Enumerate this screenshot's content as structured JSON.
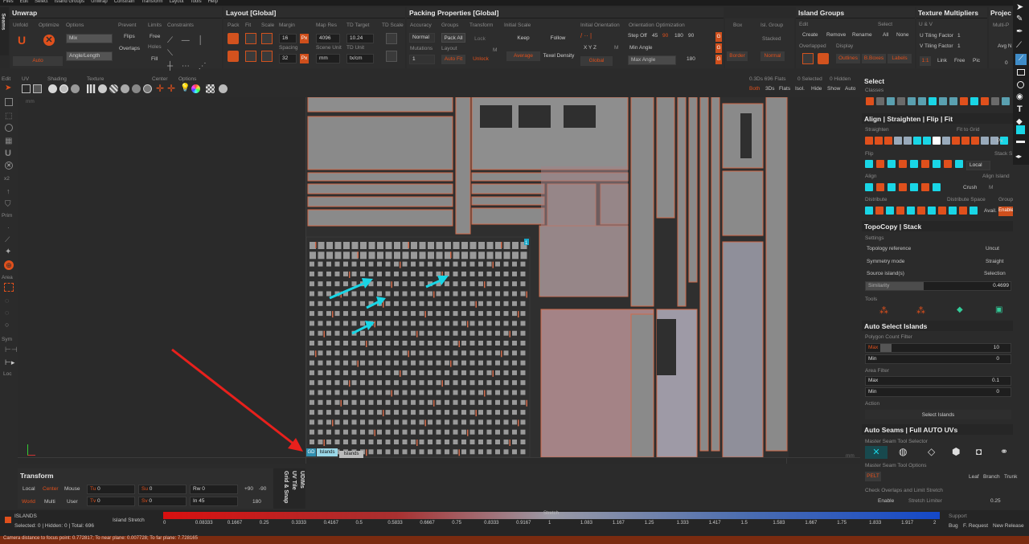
{
  "menu": {
    "items": [
      "Files",
      "Edit",
      "Select",
      "Island Groups",
      "Unwrap",
      "Constrain",
      "Transform",
      "Layout",
      "Tools",
      "Help"
    ]
  },
  "seams_tab": "Seams",
  "unwrap": {
    "title": "Unwrap",
    "sub": [
      "Unfold",
      "Optimize",
      "Options"
    ],
    "mode": "Mix",
    "angle": "Angle/Length",
    "auto": "Auto",
    "prevent": "Prevent",
    "flips": "Flips",
    "overlaps": "Overlaps",
    "limits": "Limits",
    "free": "Free",
    "holes": "Holes",
    "fill": "Fill",
    "constraints": "Constraints"
  },
  "layout": {
    "title": "Layout [Global]",
    "sub": [
      "Pack",
      "Fit",
      "Scale",
      "Margin",
      "Map Res",
      "TD Target",
      "TD Scale"
    ],
    "margin": "16",
    "px": "Px",
    "map_res": "4096",
    "td_target": "10.24",
    "spacing_lbl": "Spacing",
    "spacing": "32",
    "scene_unit_lbl": "Scene Unit",
    "scene_unit": "mm",
    "td_unit_lbl": "TD Unit",
    "td_unit": "tx/cm"
  },
  "packing": {
    "title": "Packing Properties [Global]",
    "sub": [
      "Accuracy",
      "Groups",
      "Transform",
      "Initial Scale",
      "Initial Orientation",
      "Orientation Optimization"
    ],
    "accuracy": "Normal",
    "pack_all": "Pack All",
    "lock": "Lock",
    "mutations_lbl": "Mutations",
    "mutations": "1",
    "layout_lbl": "Layout",
    "auto_fit": "Auto Fit",
    "unlock": "Unlock",
    "m": "M",
    "keep": "Keep",
    "follow": "Follow",
    "average": "Average",
    "texel_density": "Texel Density",
    "xyz": "X  Y  Z",
    "global": "Global",
    "step_off": "Step Off",
    "steps": [
      "45",
      "90",
      "180",
      "90"
    ],
    "min_angle": "Min Angle",
    "max_angle": "Max Angle",
    "max_angle_val": "180",
    "g": "G"
  },
  "box_group": {
    "box": "Box",
    "border": "Border",
    "isl_group": "Isl. Group",
    "stacked": "Stacked",
    "normal": "Normal"
  },
  "island_groups": {
    "title": "Island Groups",
    "edit": "Edit",
    "select": "Select",
    "create": "Create",
    "remove": "Remove",
    "rename": "Rename",
    "all": "All",
    "none": "None",
    "overlapped": "Overlapped",
    "display": "Display",
    "outlines": "Outlines",
    "bboxes": "B.Boxes",
    "labels": "Labels"
  },
  "tex_mult": {
    "title": "Texture Multipliers",
    "uv": "U & V",
    "u_tiling": "U Tiling Factor",
    "u_val": "1",
    "v_tiling": "V Tiling Factor",
    "v_val": "1",
    "ratio": "1:1",
    "link": "Link",
    "free": "Free",
    "pic": "Pic"
  },
  "project": {
    "title": "Projec",
    "multi": "Multi-P",
    "avg": "Avg N",
    "zero": "0"
  },
  "left_tools": {
    "edit": "Edit",
    "prim": "Prim",
    "area": "Area",
    "sym": "Sym",
    "loc": "Loc",
    "x2": "x2"
  },
  "viewport_bar": {
    "uv": "UV",
    "shading": "Shading",
    "texture": "Texture",
    "center": "Center",
    "options": "Options",
    "stats": "0.3Ds 696 Flats",
    "selected": "0 Selected",
    "hidden": "0 Hidden",
    "modes": [
      "Both",
      "3Ds",
      "Flats",
      "Isol.",
      "Hide",
      "Show",
      "Auto"
    ],
    "unit": "mm"
  },
  "viewport": {
    "islands_tag": "GD",
    "islands_label": "Islands",
    "islands2": "Islands",
    "tile_index": "1",
    "unit_right": "mm"
  },
  "select_panel": {
    "title": "Select",
    "classes": "Classes"
  },
  "align_panel": {
    "title": "Align | Straighten | Flip | Fit",
    "straighten": "Straighten",
    "fit_to_grid": "Fit to Grid",
    "px": "Px",
    "flip": "Flip",
    "stack": "Stack S",
    "local": "Local",
    "align": "Align",
    "align_island": "Align Island",
    "crush": "Crush",
    "m": "M",
    "distribute": "Distribute",
    "distribute_space": "Distribute Space",
    "group": "Group",
    "avail": "Avail.",
    "enable": "Enable"
  },
  "topocopy": {
    "title": "TopoCopy | Stack",
    "settings": "Settings",
    "topology_ref": "Topology reference",
    "topology_val": "Uncut",
    "symmetry_mode": "Symmetry mode",
    "symmetry_val": "Straight",
    "source": "Source island(s)",
    "source_val": "Selection",
    "similarity": "Similarity",
    "similarity_val": "0.4699",
    "tools": "Tools"
  },
  "auto_select": {
    "title": "Auto Select Islands",
    "poly_filter": "Polygon Count Filter",
    "max": "Max",
    "max_val": "10",
    "min": "Min",
    "min_val": "0",
    "area_filter": "Area Filter",
    "amax": "Max",
    "amax_val": "0.1",
    "amin": "Min",
    "amin_val": "0",
    "action": "Action",
    "select_islands": "Select Islands"
  },
  "auto_seams": {
    "title": "Auto Seams | Full AUTO UVs",
    "selector": "Master Seam Tool Selector",
    "options": "Master Seam Tool Options",
    "pelt": "PELT",
    "leaf": "Leaf",
    "branch": "Branch",
    "trunk": "Trunk",
    "check": "Check Overlaps and Limit Stretch",
    "enable": "Enable",
    "stretch_limiter": "Stretch Limiter",
    "stretch_val": "0.25"
  },
  "transform": {
    "title": "Transform",
    "local": "Local",
    "center": "Center",
    "mouse": "Mouse",
    "world": "World",
    "multi": "Multi",
    "user": "User",
    "tu": "Tu",
    "tu_val": "0",
    "su": "Su",
    "su_val": "0",
    "rw": "Rw",
    "rw_val": "0",
    "r90": "+90",
    "rm90": "-90",
    "tv": "Tv",
    "tv_val": "0",
    "sv": "Sv",
    "sv_val": "0",
    "in": "In",
    "in_val": "45",
    "r180": "180"
  },
  "vert_tabs": [
    "UDIMs",
    "UV Tile",
    "Grid & Snap"
  ],
  "status": {
    "mode": "ISLANDS",
    "counts": "Selected: 0 | Hidden: 0 | Total: 696",
    "stretch_mode": "Island Stretch",
    "stretch_title": "Stretch",
    "ticks": [
      "0",
      "0.08333",
      "0.1667",
      "0.25",
      "0.3333",
      "0.4167",
      "0.5",
      "0.5833",
      "0.6667",
      "0.75",
      "0.8333",
      "0.9167",
      "1",
      "1.083",
      "1.167",
      "1.25",
      "1.333",
      "1.417",
      "1.5",
      "1.583",
      "1.667",
      "1.75",
      "1.833",
      "1.917",
      "2"
    ],
    "support": "Support",
    "bug": "Bug",
    "request": "F. Request",
    "release": "New Release",
    "camera": "Camera distance to focus point: 0.772817; To near plane: 0.007728; To far plane: 7.728165"
  },
  "colors": {
    "accent": "#cf4f1c",
    "cyan": "#19d6e6",
    "arrow_red": "#e8201c",
    "island_fill": "#8c8c8c",
    "pink_island": "#a88488"
  }
}
